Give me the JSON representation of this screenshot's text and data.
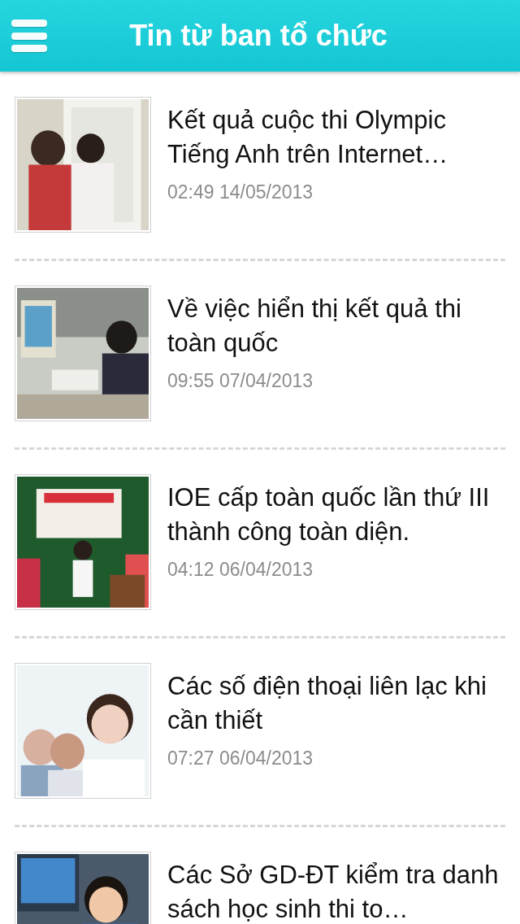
{
  "header": {
    "title": "Tin từ ban tổ chức"
  },
  "news": [
    {
      "title": "Kết quả cuộc thi Olympic Tiếng Anh trên Internet…",
      "date": "02:49 14/05/2013"
    },
    {
      "title": "Về việc hiển thị kết quả thi toàn quốc",
      "date": "09:55 07/04/2013"
    },
    {
      "title": "IOE cấp toàn quốc lần thứ III thành công toàn diện.",
      "date": "04:12 06/04/2013"
    },
    {
      "title": "Các số điện thoại liên lạc khi cần thiết",
      "date": "07:27 06/04/2013"
    },
    {
      "title": "Các Sở GD-ĐT kiểm tra danh sách học sinh thi to…"
    }
  ]
}
